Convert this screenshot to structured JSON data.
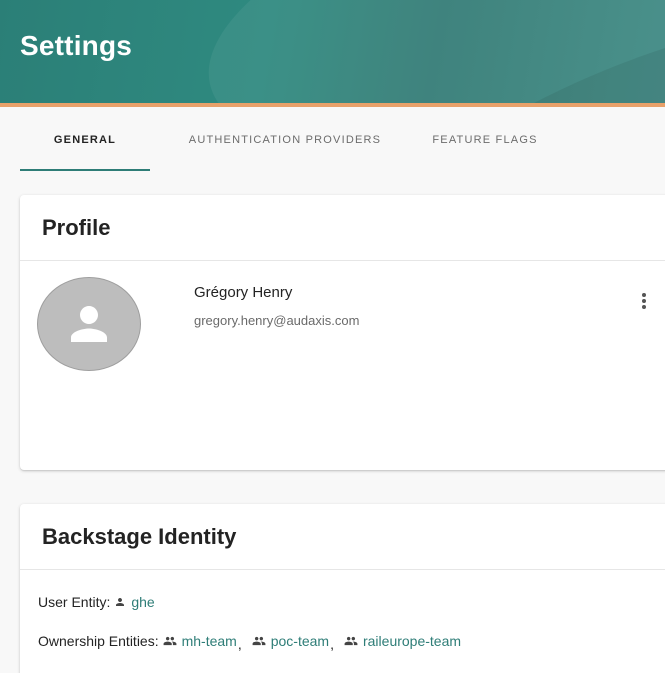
{
  "header": {
    "title": "Settings"
  },
  "tabs": [
    {
      "label": "GENERAL",
      "active": true
    },
    {
      "label": "AUTHENTICATION PROVIDERS",
      "active": false
    },
    {
      "label": "FEATURE FLAGS",
      "active": false
    }
  ],
  "profile": {
    "title": "Profile",
    "name": "Grégory Henry",
    "email": "gregory.henry@audaxis.com",
    "avatar_icon": "person-icon",
    "menu_icon": "more-vert-icon"
  },
  "identity": {
    "title": "Backstage Identity",
    "user_entity_label": "User Entity:",
    "user_entity": "ghe",
    "ownership_label": "Ownership Entities:",
    "ownership_entities": [
      "mh-team",
      "poc-team",
      "raileurope-team"
    ],
    "separator": ","
  },
  "colors": {
    "accent": "#2e7d77",
    "header_stripe": "#e8a16a"
  }
}
